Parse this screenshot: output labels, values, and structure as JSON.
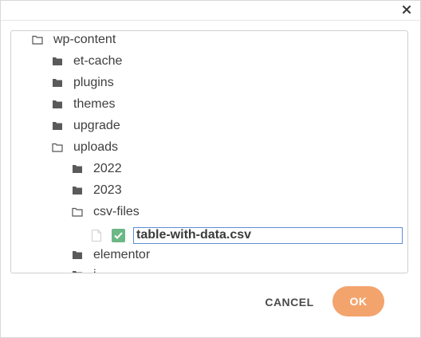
{
  "dialog": {
    "close_icon": "close-icon",
    "tree": {
      "root": "wp-content",
      "items": [
        {
          "label": "et-cache",
          "icon": "folder-closed-icon"
        },
        {
          "label": "plugins",
          "icon": "folder-closed-icon"
        },
        {
          "label": "themes",
          "icon": "folder-closed-icon"
        },
        {
          "label": "upgrade",
          "icon": "folder-closed-icon"
        },
        {
          "label": "uploads",
          "icon": "folder-open-icon"
        }
      ],
      "uploads_children": [
        {
          "label": "2022",
          "icon": "folder-closed-icon"
        },
        {
          "label": "2023",
          "icon": "folder-closed-icon"
        },
        {
          "label": "csv-files",
          "icon": "folder-open-icon"
        }
      ],
      "file": {
        "name_input_value": "table-with-data.csv",
        "icon": "file-icon",
        "checked": true
      },
      "after_file": [
        {
          "label": "elementor",
          "icon": "folder-closed-icon"
        },
        {
          "label": "i",
          "icon": "folder-closed-icon"
        }
      ]
    },
    "buttons": {
      "cancel": "CANCEL",
      "ok": "OK"
    },
    "colors": {
      "ok_bg": "#f3a46d",
      "check_bg": "#6bb886",
      "input_border": "#5b8fd4"
    }
  }
}
